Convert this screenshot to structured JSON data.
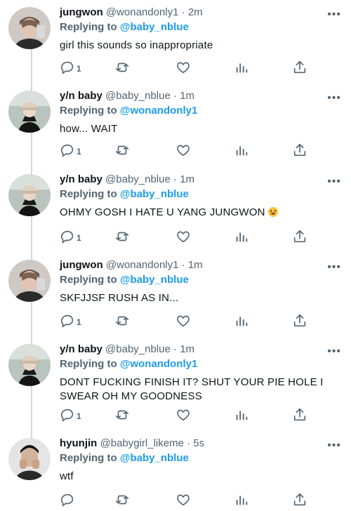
{
  "tweets": [
    {
      "avatar": "male-portrait",
      "name": "jungwon",
      "handle": "@wonandonly1",
      "dot": "·",
      "time": "2m",
      "reply_prefix": "Replying to",
      "reply_to": "@baby_nblue",
      "text": "girl this sounds so inappropriate",
      "reply_count": "1",
      "emoji": false
    },
    {
      "avatar": "girl-hat",
      "name": "y/n baby",
      "handle": "@baby_nblue",
      "dot": "·",
      "time": "1m",
      "reply_prefix": "Replying to",
      "reply_to": "@wonandonly1",
      "text": "how... WAIT",
      "reply_count": "1",
      "emoji": false
    },
    {
      "avatar": "girl-hat",
      "name": "y/n baby",
      "handle": "@baby_nblue",
      "dot": "·",
      "time": "1m",
      "reply_prefix": "Replying to",
      "reply_to": "@baby_nblue",
      "text": "OHMY GOSH I HATE U YANG JUNGWON",
      "reply_count": "1",
      "emoji": true
    },
    {
      "avatar": "male-portrait",
      "name": "jungwon",
      "handle": "@wonandonly1",
      "dot": "·",
      "time": "1m",
      "reply_prefix": "Replying to",
      "reply_to": "@baby_nblue",
      "text": "SKFJJSF RUSH AS IN...",
      "reply_count": "1",
      "emoji": false
    },
    {
      "avatar": "girl-hat",
      "name": "y/n baby",
      "handle": "@baby_nblue",
      "dot": "·",
      "time": "1m",
      "reply_prefix": "Replying to",
      "reply_to": "@wonandonly1",
      "text": "DONT FUCKING FINISH IT? SHUT YOUR PIE HOLE I SWEAR OH MY GOODNESS",
      "reply_count": "1",
      "emoji": false
    },
    {
      "avatar": "male-hands",
      "name": "hyunjin",
      "handle": "@babygirl_likeme",
      "dot": "·",
      "time": "5s",
      "reply_prefix": "Replying to",
      "reply_to": "@baby_nblue",
      "text": "wtf",
      "reply_count": "",
      "emoji": false
    }
  ],
  "icons": {
    "more": "more-horizontal-icon",
    "reply": "reply-icon",
    "retweet": "retweet-icon",
    "like": "heart-icon",
    "views": "analytics-icon",
    "share": "share-icon"
  },
  "colors": {
    "accent": "#1d9bf0",
    "muted": "#536471",
    "text": "#0f1419",
    "thread_line": "#cfd9de"
  }
}
